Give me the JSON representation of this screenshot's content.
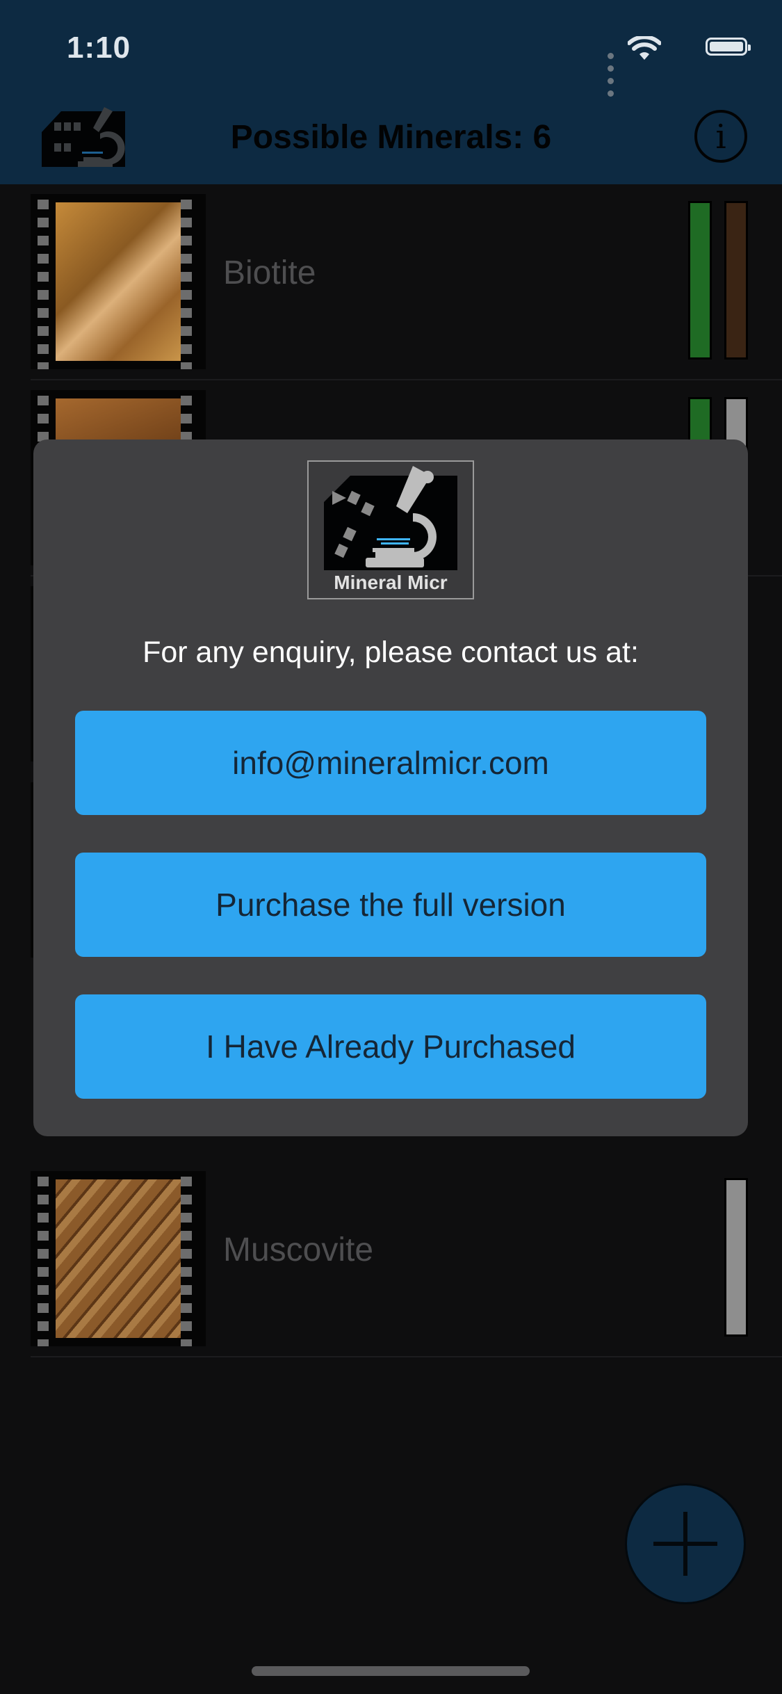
{
  "status_bar": {
    "time": "1:10"
  },
  "nav": {
    "title": "Possible Minerals: 6",
    "info_label": "i"
  },
  "minerals": [
    {
      "name": "Biotite",
      "thumb_colors": [
        "#c58a3a",
        "#8a5a22",
        "#dcb07a"
      ],
      "bars": [
        "#1f6b24",
        "#3a2414"
      ]
    },
    {
      "name": "",
      "thumb_colors": [
        "#a5682e",
        "#6a3c16",
        "#c38848"
      ],
      "bars": [
        "#1f6b24",
        "#8e8e8e"
      ]
    },
    {
      "name": "Muscovite",
      "thumb_colors": [
        "#8b5a2a",
        "#5c3616",
        "#a97a44"
      ],
      "bars": [
        "#8e8e8e"
      ]
    }
  ],
  "dialog": {
    "logo_text": "Mineral Micr",
    "message": "For any enquiry, please contact us at:",
    "email_button": "info@mineralmicr.com",
    "purchase_button": "Purchase the full version",
    "restore_button": "I Have Already Purchased"
  },
  "colors": {
    "nav_background": "#0d2a42",
    "dialog_background": "#404042",
    "button_accent": "#2ea5f0"
  }
}
